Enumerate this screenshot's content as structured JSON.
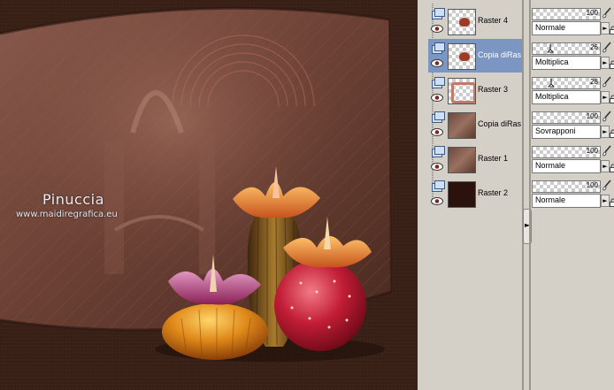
{
  "canvas": {
    "watermark_name": "Pinuccia",
    "watermark_url": "www.maidiregrafica.eu"
  },
  "layers": [
    {
      "name": "Raster 4",
      "selected": false,
      "opacity": 100,
      "blend": "Normale",
      "thumb": "flower-transparent"
    },
    {
      "name": "Copia diRas",
      "selected": true,
      "opacity": 26,
      "blend": "Moltiplica",
      "thumb": "flower-transparent"
    },
    {
      "name": "Raster 3",
      "selected": false,
      "opacity": 28,
      "blend": "Moltiplica",
      "thumb": "frame-transparent"
    },
    {
      "name": "Copia diRas",
      "selected": false,
      "opacity": 100,
      "blend": "Sovrapponi",
      "thumb": "brown-texture"
    },
    {
      "name": "Raster 1",
      "selected": false,
      "opacity": 100,
      "blend": "Normale",
      "thumb": "brown-texture"
    },
    {
      "name": "Raster 2",
      "selected": false,
      "opacity": 100,
      "blend": "Normale",
      "thumb": "dark-brown"
    }
  ],
  "colors": {
    "selected_row": "#7c96c4",
    "panel_bg": "#d4d0c8",
    "canvas_bg": "#3a2118"
  }
}
